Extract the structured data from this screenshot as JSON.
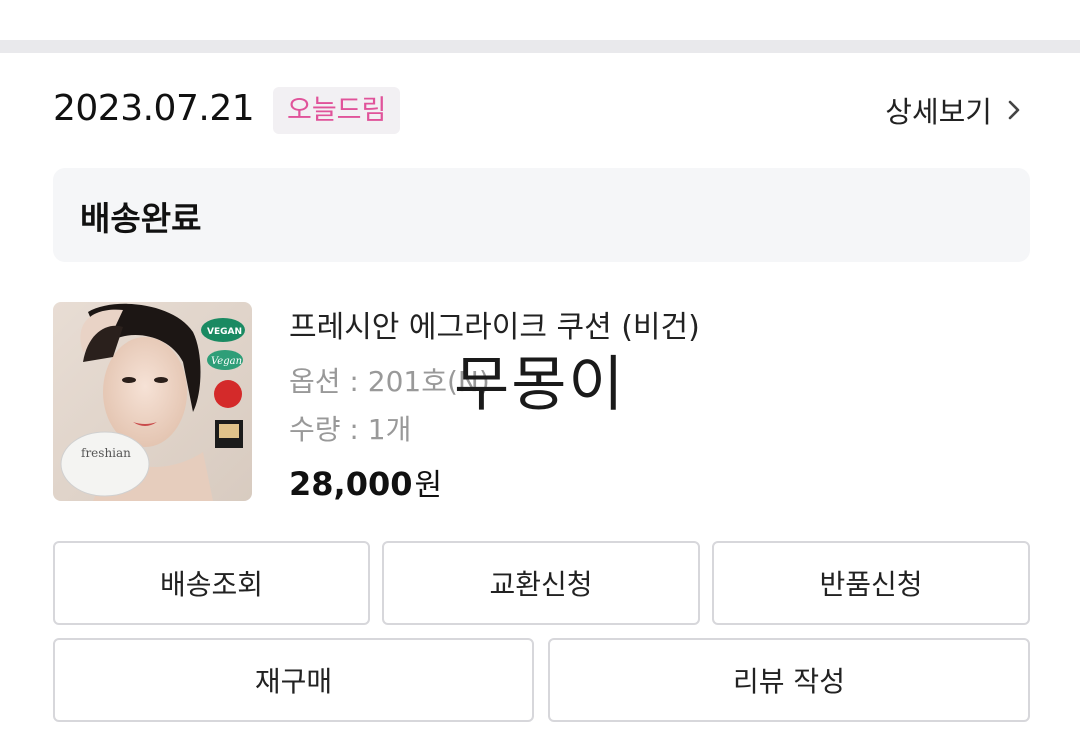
{
  "order": {
    "date": "2023.07.21",
    "badge": "오늘드림",
    "detail_label": "상세보기",
    "status": "배송완료"
  },
  "product": {
    "name": "프레시안 에그라이크 쿠션 (비건)",
    "option": "옵션 : 201호(N)",
    "quantity": "수량 : 1개",
    "price": "28,000",
    "price_unit": "원",
    "image_brand": "freshian",
    "image_badges": [
      "VEGAN",
      "Vegan"
    ]
  },
  "watermark": "무몽이",
  "buttons": {
    "track": "배송조회",
    "exchange": "교환신청",
    "return": "반품신청",
    "rebuy": "재구매",
    "review": "리뷰 작성"
  },
  "colors": {
    "badge_text": "#e0539a",
    "badge_bg": "#f2f0f3",
    "status_bg": "#f5f6f8",
    "divider": "#e9e9ec",
    "button_border": "#d7d7db"
  }
}
